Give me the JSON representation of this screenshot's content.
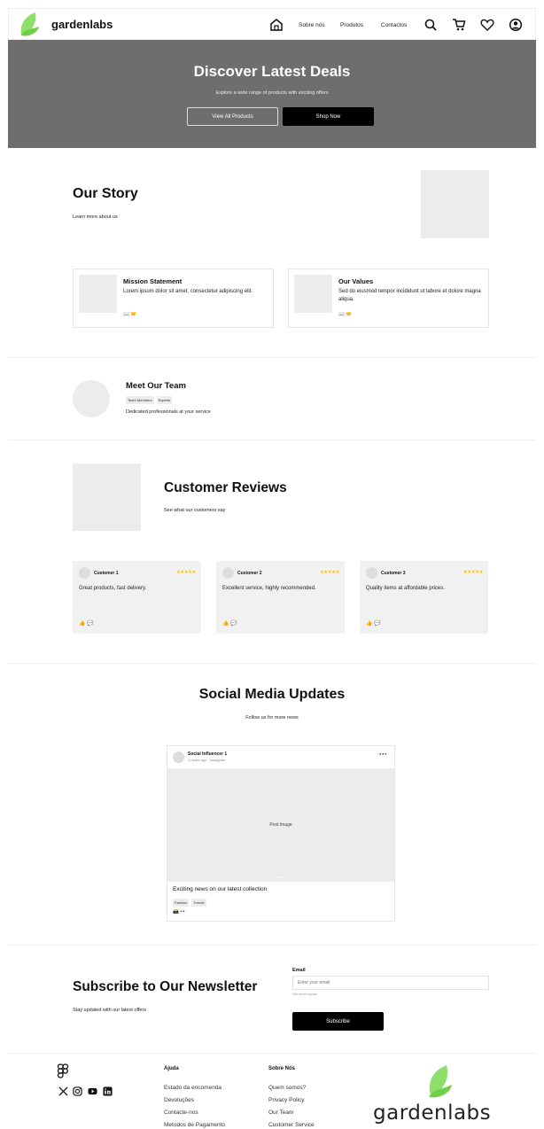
{
  "header": {
    "brand": "gardenlabs",
    "nav": [
      "Sobre nós",
      "Produtos",
      "Contactos"
    ],
    "icons": [
      "home-icon",
      "search-icon",
      "cart-icon",
      "heart-icon",
      "user-icon"
    ]
  },
  "hero": {
    "title": "Discover Latest Deals",
    "subtitle": "Explore a wide range of products with exciting offers",
    "btn_secondary": "View All Products",
    "btn_primary": "Shop Now"
  },
  "story": {
    "title": "Our Story",
    "subtitle": "Learn more about us",
    "cards": [
      {
        "title": "Mission Statement",
        "text": "Lorem ipsum dolor sit amet, consectetur adipiscing elit.",
        "icons": "📖  🤝"
      },
      {
        "title": "Our Values",
        "text": "Sed do eiusmod tempor incididunt ut labore et dolore magna aliqua.",
        "icons": "📖  🤝"
      }
    ]
  },
  "team": {
    "title": "Meet Our Team",
    "tags": [
      "Team Members",
      "Experts"
    ],
    "subtitle": "Dedicated professionals at your service"
  },
  "reviews": {
    "title": "Customer Reviews",
    "subtitle": "See what our customers say",
    "items": [
      {
        "name": "Customer 1",
        "stars": "★★★★★",
        "text": "Great products, fast delivery.",
        "icons": "👍  💬"
      },
      {
        "name": "Customer 2",
        "stars": "★★★★★",
        "text": "Excellent service, highly recommended.",
        "icons": "👍  💬"
      },
      {
        "name": "Customer 3",
        "stars": "★★★★★",
        "text": "Quality items at affordable prices.",
        "icons": "👍  💬"
      }
    ]
  },
  "social": {
    "title": "Social Media Updates",
    "subtitle": "Follow us for more news",
    "post": {
      "author": "Social Influencer 1",
      "meta": "2 hours ago · Instagram",
      "more": "···",
      "image_label": "Post Image",
      "dots": "● ● ● ●",
      "caption": "Exciting news on our latest collection",
      "tags": [
        "Fashion",
        "Trends"
      ],
      "reactions": "📸  👀"
    }
  },
  "newsletter": {
    "title": "Subscribe to Our Newsletter",
    "subtitle": "Stay updated with our latest offers",
    "email_label": "Email",
    "email_placeholder": "Enter your email",
    "hint": "We never spam",
    "button": "Subscribe"
  },
  "footer": {
    "social_icons": [
      "figma-icon",
      "x-icon",
      "instagram-icon",
      "youtube-icon",
      "linkedin-icon"
    ],
    "col1": {
      "heading": "Ajuda",
      "links": [
        "Estado da encomenda",
        "Devoluções",
        "Contacte-nos",
        "Metodos de Pagamento"
      ]
    },
    "col2": {
      "heading": "Sobre Nós",
      "links": [
        "Quem somos?",
        "Privacy Policy",
        "Our Team",
        "Customer Service"
      ]
    },
    "brand": "gardenlabs"
  },
  "colors": {
    "accent_green": "#7ed957",
    "hero_bg": "#6e6e6e",
    "stars": "#f5c518"
  }
}
